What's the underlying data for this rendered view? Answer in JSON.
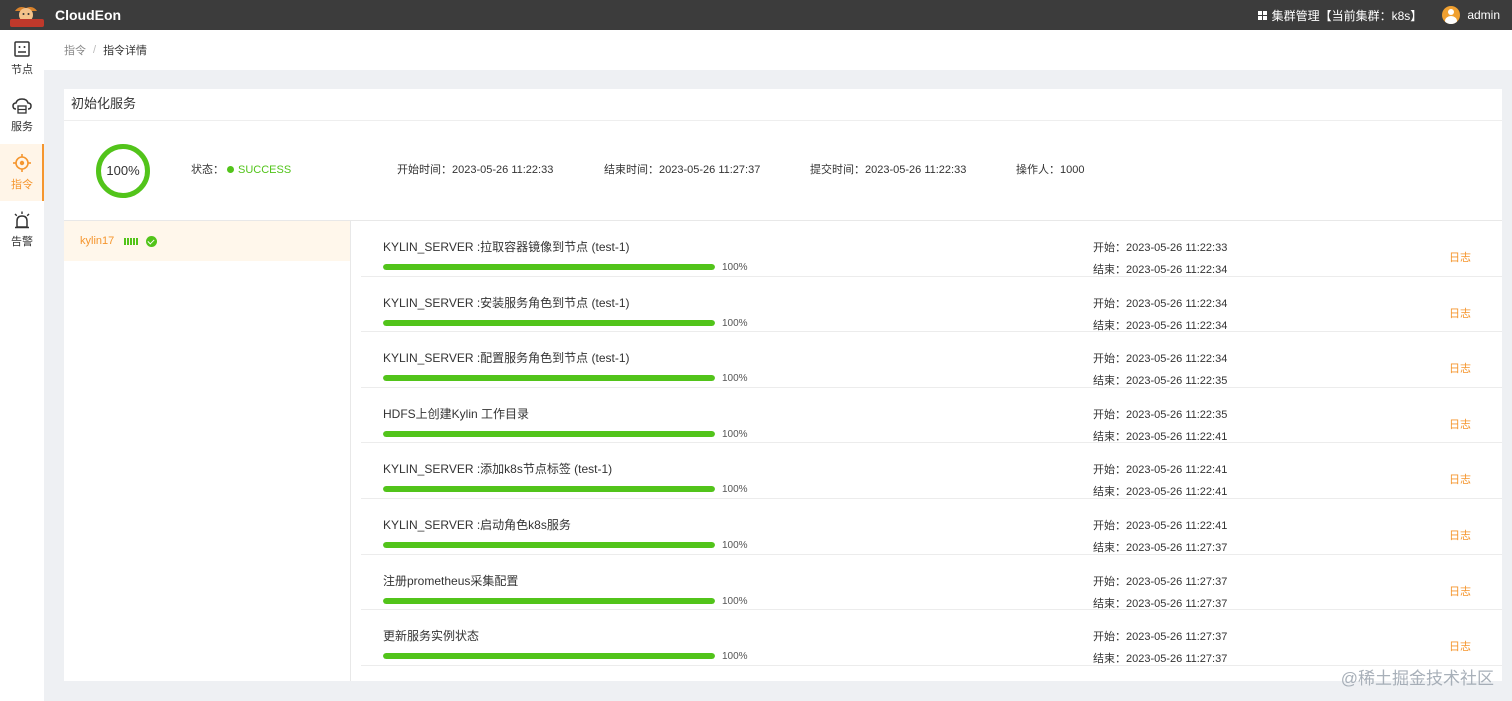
{
  "app": {
    "brand": "CloudEon",
    "logo_text": "CloudEon"
  },
  "header": {
    "cluster_label": "集群管理【当前集群：k8s】",
    "user": "admin"
  },
  "sidebar": {
    "items": [
      {
        "label": "节点",
        "icon": "node-icon"
      },
      {
        "label": "服务",
        "icon": "service-icon"
      },
      {
        "label": "指令",
        "icon": "command-icon",
        "active": true
      },
      {
        "label": "告警",
        "icon": "alarm-icon"
      }
    ]
  },
  "breadcrumb": {
    "parent": "指令",
    "separator": "/",
    "current": "指令详情"
  },
  "command": {
    "title": "初始化服务",
    "progress_text": "100%",
    "progress": 100,
    "status_label": "状态：",
    "status_value": "SUCCESS",
    "start_label": "开始时间：",
    "start_value": "2023-05-26 11:22:33",
    "end_label": "结束时间：",
    "end_value": "2023-05-26 11:27:37",
    "submit_label": "提交时间：",
    "submit_value": "2023-05-26 11:22:33",
    "operator_label": "操作人：",
    "operator_value": "1000"
  },
  "host": {
    "name": "kylin17"
  },
  "labels": {
    "start": "开始：",
    "end": "结束：",
    "log": "日志"
  },
  "tasks": [
    {
      "name": "KYLIN_SERVER :拉取容器镜像到节点 (test-1)",
      "progress": 100,
      "progress_text": "100%",
      "start": "2023-05-26 11:22:33",
      "end": "2023-05-26 11:22:34"
    },
    {
      "name": "KYLIN_SERVER :安装服务角色到节点 (test-1)",
      "progress": 100,
      "progress_text": "100%",
      "start": "2023-05-26 11:22:34",
      "end": "2023-05-26 11:22:34"
    },
    {
      "name": "KYLIN_SERVER :配置服务角色到节点 (test-1)",
      "progress": 100,
      "progress_text": "100%",
      "start": "2023-05-26 11:22:34",
      "end": "2023-05-26 11:22:35"
    },
    {
      "name": "HDFS上创建Kylin 工作目录",
      "progress": 100,
      "progress_text": "100%",
      "start": "2023-05-26 11:22:35",
      "end": "2023-05-26 11:22:41"
    },
    {
      "name": "KYLIN_SERVER :添加k8s节点标签 (test-1)",
      "progress": 100,
      "progress_text": "100%",
      "start": "2023-05-26 11:22:41",
      "end": "2023-05-26 11:22:41"
    },
    {
      "name": "KYLIN_SERVER :启动角色k8s服务",
      "progress": 100,
      "progress_text": "100%",
      "start": "2023-05-26 11:22:41",
      "end": "2023-05-26 11:27:37"
    },
    {
      "name": "注册prometheus采集配置",
      "progress": 100,
      "progress_text": "100%",
      "start": "2023-05-26 11:27:37",
      "end": "2023-05-26 11:27:37"
    },
    {
      "name": "更新服务实例状态",
      "progress": 100,
      "progress_text": "100%",
      "start": "2023-05-26 11:27:37",
      "end": "2023-05-26 11:27:37"
    }
  ],
  "watermark": "@稀土掘金技术社区",
  "colors": {
    "accent": "#f5962e",
    "success": "#52c41a",
    "topbar": "#3c3c3c"
  }
}
